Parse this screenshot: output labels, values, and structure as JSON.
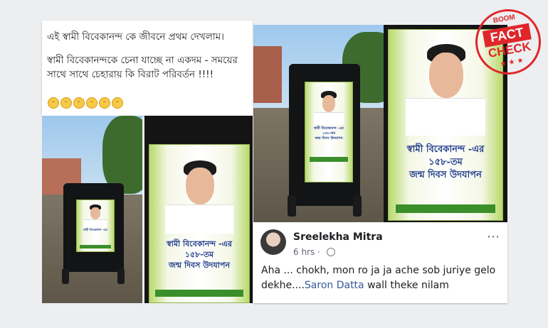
{
  "post": {
    "line1": "এই স্বামী বিবেকানন্দ কে জীবনে প্রথম দেখলাম।",
    "line2": "স্বামী বিবেকানন্দকে চেনা যাচ্ছে না একদম - সময়ের সাথে সাথে চেহারায় কি বিরাট পরিবর্তন !!!!",
    "emoji_face": "😀"
  },
  "banner": {
    "title_line1": "স্বামী বিবেকানন্দ -এর",
    "title_line2": "১৫৮-তম",
    "title_line3": "জন্ম দিবস উদযাপন"
  },
  "comment": {
    "author": "Sreelekha Mitra",
    "time": "6 hrs ·",
    "more_icon": "⋯",
    "text_before": "Aha ... chokh, mon ro ja ja ache sob juriye gelo dekhe....",
    "link_text": "Saron Datta",
    "text_after": " wall theke nilam"
  },
  "stamp": {
    "brand": "BOOM",
    "word1": "FACT",
    "word2": "CHECK",
    "stars": "★ ★ ★"
  },
  "colors": {
    "accent_red": "#e0262b",
    "link": "#385898",
    "banner_green": "#8fb24a"
  }
}
